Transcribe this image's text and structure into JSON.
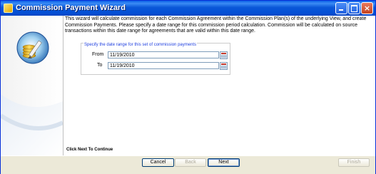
{
  "window": {
    "title": "Commission Payment Wizard",
    "controls": {
      "minimize": "minimize",
      "maximize": "maximize",
      "close": "×"
    }
  },
  "intro": "This wizard will calculate commission for each Commission Agreement within the Commission Plan(s) of the underlying View, and create Commission Payments. Please specify a date range for this commission period calculation. Commission will be calculated on source transactions within this date range for agreements that are valid within this date range.",
  "date_range": {
    "group_title": "Specify the date range for this set of commission payments",
    "from_label": "From",
    "from_value": "11/19/2010",
    "to_label": "To",
    "to_value": "11/19/2010"
  },
  "footer_text": "Click Next To Continue",
  "buttons": {
    "cancel": "Cancel",
    "back": "Back",
    "next": "Next",
    "finish": "Finish"
  },
  "colors": {
    "titlebar": "#0a57d8",
    "group_title": "#1f3fdf",
    "field_border": "#7f9db9"
  }
}
